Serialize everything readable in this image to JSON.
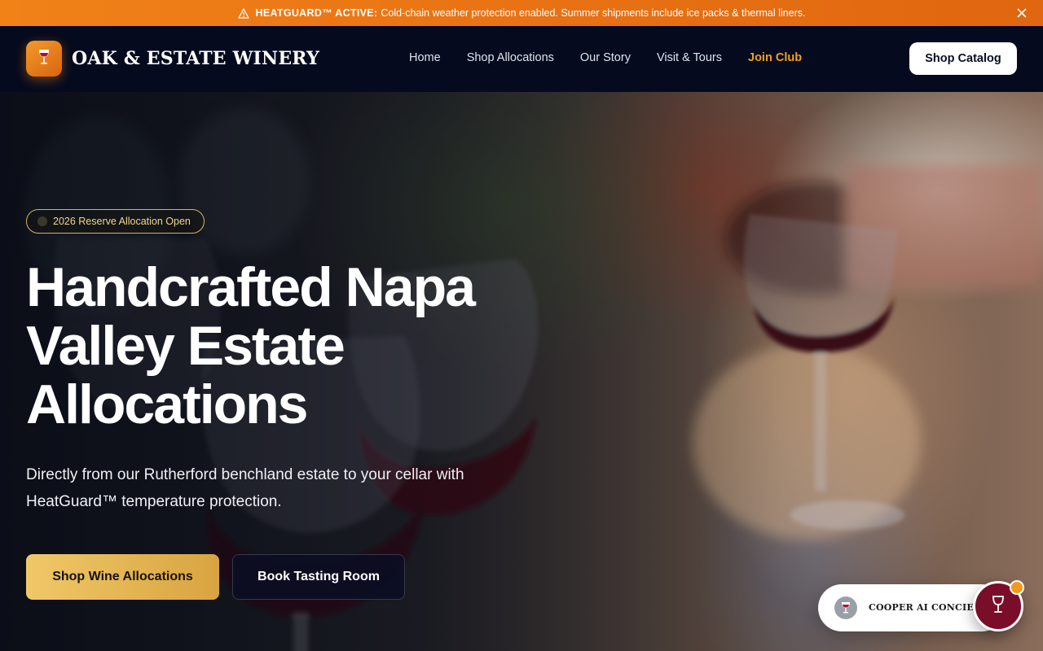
{
  "alert": {
    "label": "HEATGUARD™ ACTIVE:",
    "message": "Cold-chain weather protection enabled. Summer shipments include ice packs & thermal liners.",
    "icons": {
      "warning": "warning-triangle-icon",
      "close": "close-icon"
    }
  },
  "header": {
    "brand": "OAK & ESTATE WINERY",
    "logo_icon": "wine-glass-icon",
    "nav": [
      {
        "label": "Home"
      },
      {
        "label": "Shop Allocations"
      },
      {
        "label": "Our Story"
      },
      {
        "label": "Visit & Tours"
      },
      {
        "label": "Join Club"
      }
    ],
    "shop_button": "Shop Catalog"
  },
  "hero": {
    "badge": "2026 Reserve Allocation Open",
    "headline": "Handcrafted Napa Valley Estate Allocations",
    "subtitle": "Directly from our Rutherford benchland estate to your cellar with HeatGuard™ temperature protection.",
    "cta_primary": "Shop Wine Allocations",
    "cta_secondary": "Book Tasting Room"
  },
  "concierge": {
    "label": "COOPER AI CONCIERGE",
    "avatar_icon": "wine-glass-icon",
    "fab_icon": "wine-glass-icon"
  },
  "colors": {
    "alert_bg": "#ea7414",
    "header_bg": "#050a1e",
    "accent_gold": "#d8a440",
    "join_club": "#f0a020",
    "fab": "#7a0d2a"
  }
}
